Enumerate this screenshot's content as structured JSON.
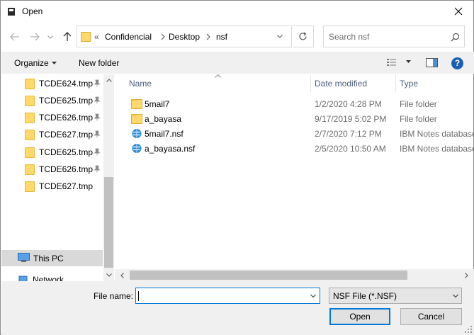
{
  "window": {
    "title": "Open"
  },
  "address": {
    "overflow": "«",
    "crumbs": [
      "Confidencial",
      "Desktop",
      "nsf"
    ]
  },
  "search": {
    "placeholder": "Search nsf"
  },
  "toolbar": {
    "organize": "Organize",
    "new_folder": "New folder"
  },
  "tree": {
    "items": [
      {
        "label": "TCDE624.tmp",
        "pinned": true
      },
      {
        "label": "TCDE625.tmp",
        "pinned": true
      },
      {
        "label": "TCDE626.tmp",
        "pinned": true
      },
      {
        "label": "TCDE627.tmp",
        "pinned": true
      },
      {
        "label": "TCDE625.tmp",
        "pinned": true
      },
      {
        "label": "TCDE626.tmp",
        "pinned": true
      },
      {
        "label": "TCDE627.tmp",
        "pinned": false
      }
    ],
    "this_pc": "This PC",
    "network": "Network"
  },
  "columns": {
    "name": "Name",
    "date": "Date modified",
    "type": "Type"
  },
  "files": [
    {
      "name": "5mail7",
      "date": "1/2/2020 4:28 PM",
      "type": "File folder",
      "icon": "folder-icon"
    },
    {
      "name": "a_bayasa",
      "date": "9/17/2019 5:02 PM",
      "type": "File folder",
      "icon": "folder-icon"
    },
    {
      "name": "5mail7.nsf",
      "date": "2/7/2020 7:12 PM",
      "type": "IBM Notes database",
      "icon": "notes-db-icon"
    },
    {
      "name": "a_bayasa.nsf",
      "date": "2/5/2020 10:50 AM",
      "type": "IBM Notes database",
      "icon": "notes-db-icon"
    }
  ],
  "bottom": {
    "file_name_label": "File name:",
    "file_name_value": "",
    "filter": "NSF File (*.NSF)",
    "open": "Open",
    "cancel": "Cancel"
  },
  "colors": {
    "accent": "#0078d7",
    "folder": "#ffd96b",
    "selected_tree": "#d9d9d9"
  }
}
